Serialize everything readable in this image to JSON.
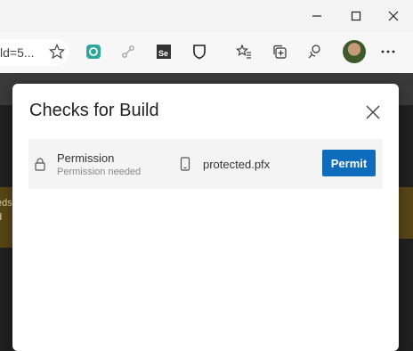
{
  "browser": {
    "address_text": "ld=5...",
    "window_controls": [
      "minimize",
      "maximize",
      "close"
    ],
    "toolbar_icons": [
      "extension-icon",
      "link-icon",
      "selenium-icon",
      "shield-icon",
      "favorites-icon",
      "collections-icon",
      "feedback-icon",
      "profile-avatar",
      "more-icon"
    ]
  },
  "background": {
    "banner_text_line1": "eds",
    "banner_text_line2": "d"
  },
  "modal": {
    "title": "Checks for Build",
    "checks": [
      {
        "type": "Permission",
        "status": "Permission needed",
        "resource": "protected.pfx",
        "action": "Permit"
      }
    ]
  },
  "colors": {
    "primary_button": "#0f6cbd",
    "row_background": "#f4f4f4",
    "banner": "#574616"
  }
}
